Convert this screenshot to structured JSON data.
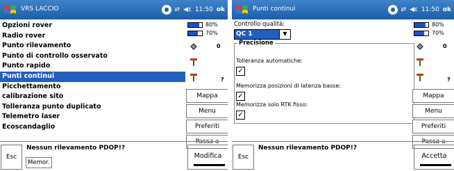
{
  "screen1": {
    "app_title": "VRS LACCIO",
    "time": "11:50",
    "ok_label": "ok",
    "menu_items": [
      "Opzioni rover",
      "Radio rover",
      "Punto rilevamento",
      "Punto di controllo osservato",
      "Punto rapido",
      "Punti continui",
      "Picchettamento",
      "calibrazione sito",
      "Tolleranza punto duplicato",
      "Telemetro laser",
      "Ecoscandaglio"
    ],
    "selected_index": 5,
    "status": {
      "battery1": "80%",
      "battery2": "70%",
      "sat_count": "0",
      "unknown": "?"
    },
    "side_buttons": [
      "Mappa",
      "Menu",
      "Preferiti",
      "Passa a"
    ],
    "bottom": {
      "left_button": "Esc",
      "warning": "Nessun rilevamento  PDOP!?",
      "memor": "Memor.",
      "right_button": "Modifica"
    }
  },
  "screen2": {
    "app_title": "Punti continui",
    "time": "11:50",
    "ok_label": "ok",
    "quality_label": "Controllo qualità:",
    "quality_value": "QC 1",
    "group_title": "Precisione",
    "checks": [
      {
        "label": "Tolleranza automatiche:",
        "checked": true
      },
      {
        "label": "Memorizza posizioni di latenza basse:",
        "checked": true
      },
      {
        "label": "Memorizza solo RTK fisso:",
        "checked": true
      }
    ],
    "status": {
      "battery1": "80%",
      "battery2": "70%",
      "sat_count": "0",
      "unknown": "?"
    },
    "side_buttons": [
      "Mappa",
      "Menu",
      "Preferiti",
      "Passa a"
    ],
    "bottom": {
      "left_button": "Esc",
      "warning": "Nessun rilevamento  PDOP!?",
      "right_button": "Accetta"
    }
  },
  "colors": {
    "titlebar": "#1d5ea8",
    "selection": "#1f5fc0",
    "battery": "#1b4fd6"
  }
}
